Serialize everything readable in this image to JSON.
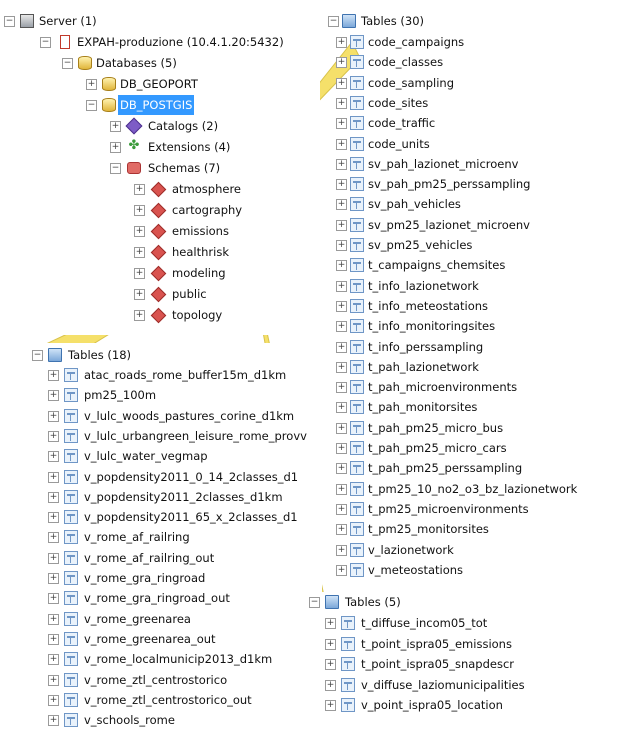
{
  "server_tree": {
    "server": "Server (1)",
    "connection": "EXPAH-produzione (10.4.1.20:5432)",
    "databases": "Databases (5)",
    "db_geoport": "DB_GEOPORT",
    "db_postgis": "DB_POSTGIS",
    "catalogs": "Catalogs (2)",
    "extensions": "Extensions (4)",
    "schemas": "Schemas (7)",
    "schema_list": [
      "atmosphere",
      "cartography",
      "emissions",
      "healthrisk",
      "modeling",
      "public",
      "topology"
    ]
  },
  "atmosphere_tables": {
    "header": "Tables (30)",
    "items": [
      "code_campaigns",
      "code_classes",
      "code_sampling",
      "code_sites",
      "code_traffic",
      "code_units",
      "sv_pah_lazionet_microenv",
      "sv_pah_pm25_perssampling",
      "sv_pah_vehicles",
      "sv_pm25_lazionet_microenv",
      "sv_pm25_vehicles",
      "t_campaigns_chemsites",
      "t_info_lazionetwork",
      "t_info_meteostations",
      "t_info_monitoringsites",
      "t_info_perssampling",
      "t_pah_lazionetwork",
      "t_pah_microenvironments",
      "t_pah_monitorsites",
      "t_pah_pm25_micro_bus",
      "t_pah_pm25_micro_cars",
      "t_pah_pm25_perssampling",
      "t_pm25_10_no2_o3_bz_lazionetwork",
      "t_pm25_microenvironments",
      "t_pm25_monitorsites",
      "v_lazionetwork",
      "v_meteostations"
    ]
  },
  "healthrisk_tables": {
    "header": "Tables (18)",
    "items": [
      "atac_roads_rome_buffer15m_d1km",
      "pm25_100m",
      "v_lulc_woods_pastures_corine_d1km",
      "v_lulc_urbangreen_leisure_rome_provv",
      "v_lulc_water_vegmap",
      "v_popdensity2011_0_14_2classes_d1",
      "v_popdensity2011_2classes_d1km",
      "v_popdensity2011_65_x_2classes_d1",
      "v_rome_af_railring",
      "v_rome_af_railring_out",
      "v_rome_gra_ringroad",
      "v_rome_gra_ringroad_out",
      "v_rome_greenarea",
      "v_rome_greenarea_out",
      "v_rome_localmunicip2013_d1km",
      "v_rome_ztl_centrostorico",
      "v_rome_ztl_centrostorico_out",
      "v_schools_rome"
    ]
  },
  "emissions_tables": {
    "header": "Tables (5)",
    "items": [
      "t_diffuse_incom05_tot",
      "t_point_ispra05_emissions",
      "t_point_ispra05_snapdescr",
      "v_diffuse_laziomunicipalities",
      "v_point_ispra05_location"
    ]
  },
  "colors": {
    "callout": "#f5e06a",
    "selection": "#3399ff",
    "table_icon": "#6f96c6"
  },
  "icons": {
    "expander": "plus-minus-box",
    "table": "table-icon",
    "folder": "tables-folder-icon",
    "schema": "schema-diamond-icon",
    "database": "database-cylinder-icon"
  }
}
